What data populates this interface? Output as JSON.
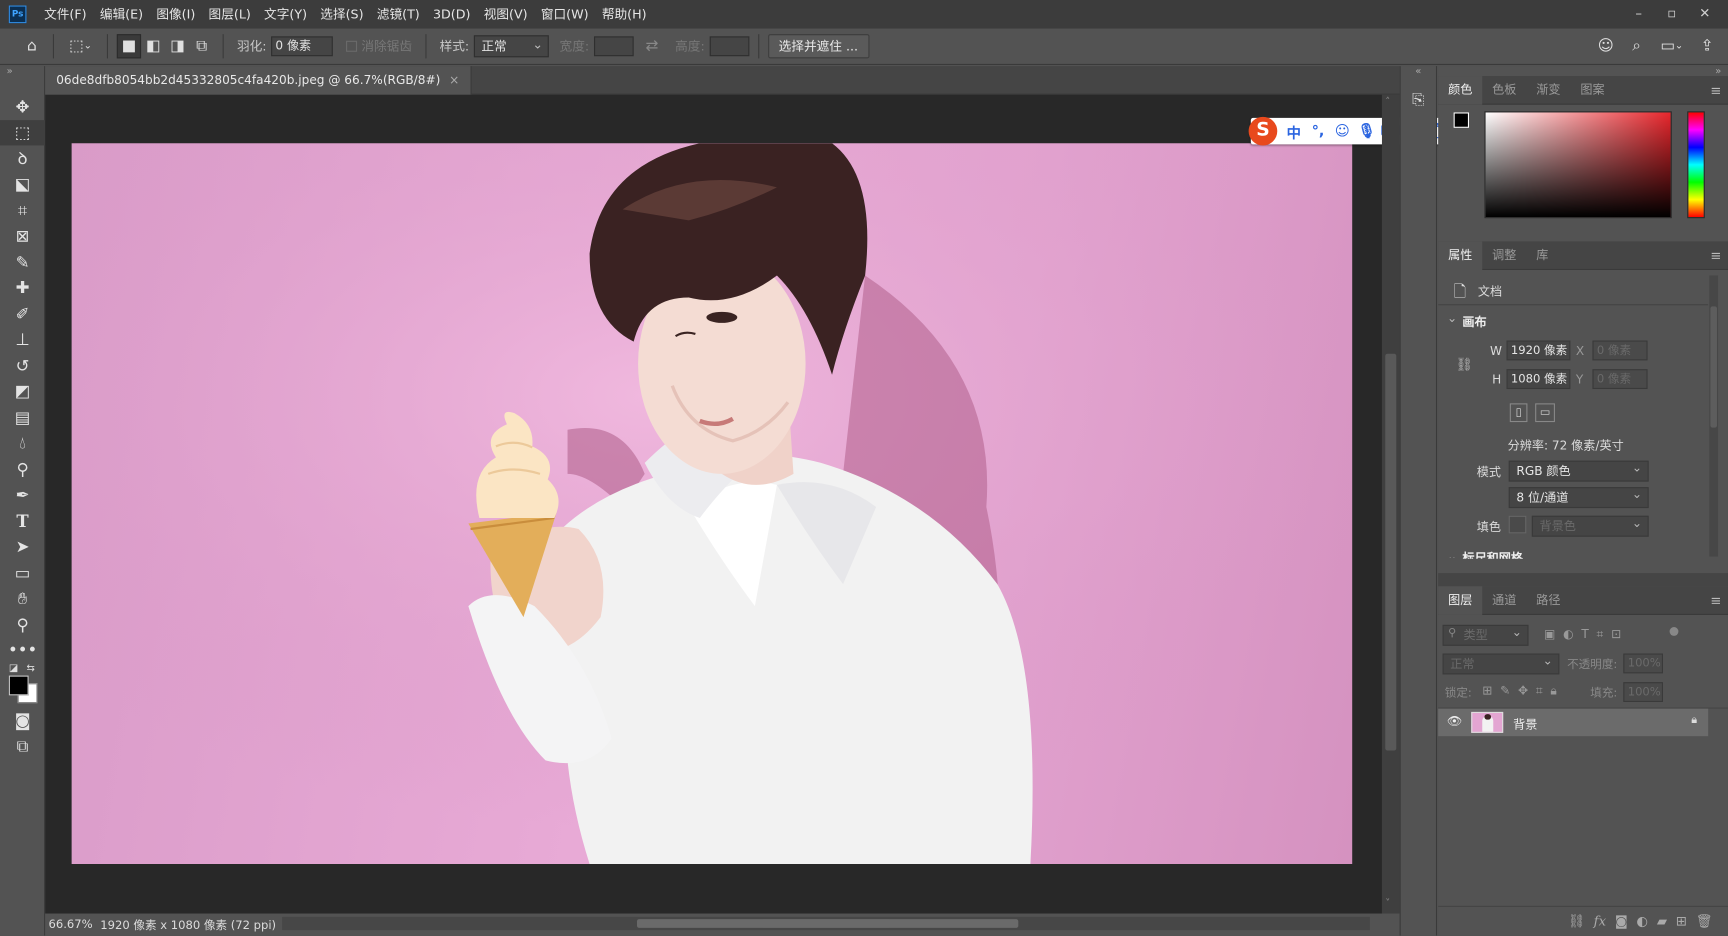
{
  "menubar": {
    "logo": "Ps",
    "items": [
      "文件(F)",
      "编辑(E)",
      "图像(I)",
      "图层(L)",
      "文字(Y)",
      "选择(S)",
      "滤镜(T)",
      "3D(D)",
      "视图(V)",
      "窗口(W)",
      "帮助(H)"
    ]
  },
  "options": {
    "feather_label": "羽化:",
    "feather_value": "0 像素",
    "antialias_label": "消除锯齿",
    "style_label": "样式:",
    "style_value": "正常",
    "width_label": "宽度:",
    "height_label": "高度:",
    "select_mask_button": "选择并遮住 ..."
  },
  "document": {
    "tab_title": "06de8dfb8054bb2d45332805c4fa420b.jpeg @ 66.7%(RGB/8#)",
    "close_glyph": "×"
  },
  "status": {
    "zoom": "66.67%",
    "doc_info": "1920 像素 x 1080 像素 (72 ppi)",
    "arrow": "›"
  },
  "ime": {
    "logo": "S",
    "mode": "中",
    "punct": "°,"
  },
  "color_panel": {
    "tabs": [
      "颜色",
      "色板",
      "渐变",
      "图案"
    ]
  },
  "properties_panel": {
    "tabs": [
      "属性",
      "调整",
      "库"
    ],
    "doc_label": "文档",
    "section_canvas": "画布",
    "w_label": "W",
    "w_value": "1920 像素",
    "h_label": "H",
    "h_value": "1080 像素",
    "x_label": "X",
    "x_value": "0 像素",
    "y_label": "Y",
    "y_value": "0 像素",
    "resolution": "分辨率: 72 像素/英寸",
    "mode_label": "模式",
    "mode_value": "RGB 颜色",
    "depth_value": "8 位/通道",
    "fill_label": "填色",
    "fill_value": "背景色",
    "next_section": "标尺和网格"
  },
  "layers_panel": {
    "tabs": [
      "图层",
      "通道",
      "路径"
    ],
    "filter_placeholder": "类型",
    "blend_mode": "正常",
    "opacity_label": "不透明度:",
    "opacity_value": "100%",
    "lock_label": "锁定:",
    "fill_label": "填充:",
    "fill_value": "100%",
    "layer_name": "背景"
  },
  "colors": {
    "photo_pink": "#e3a5d2",
    "ime_blue": "#2a64e0",
    "ime_orange": "#e8491d"
  }
}
